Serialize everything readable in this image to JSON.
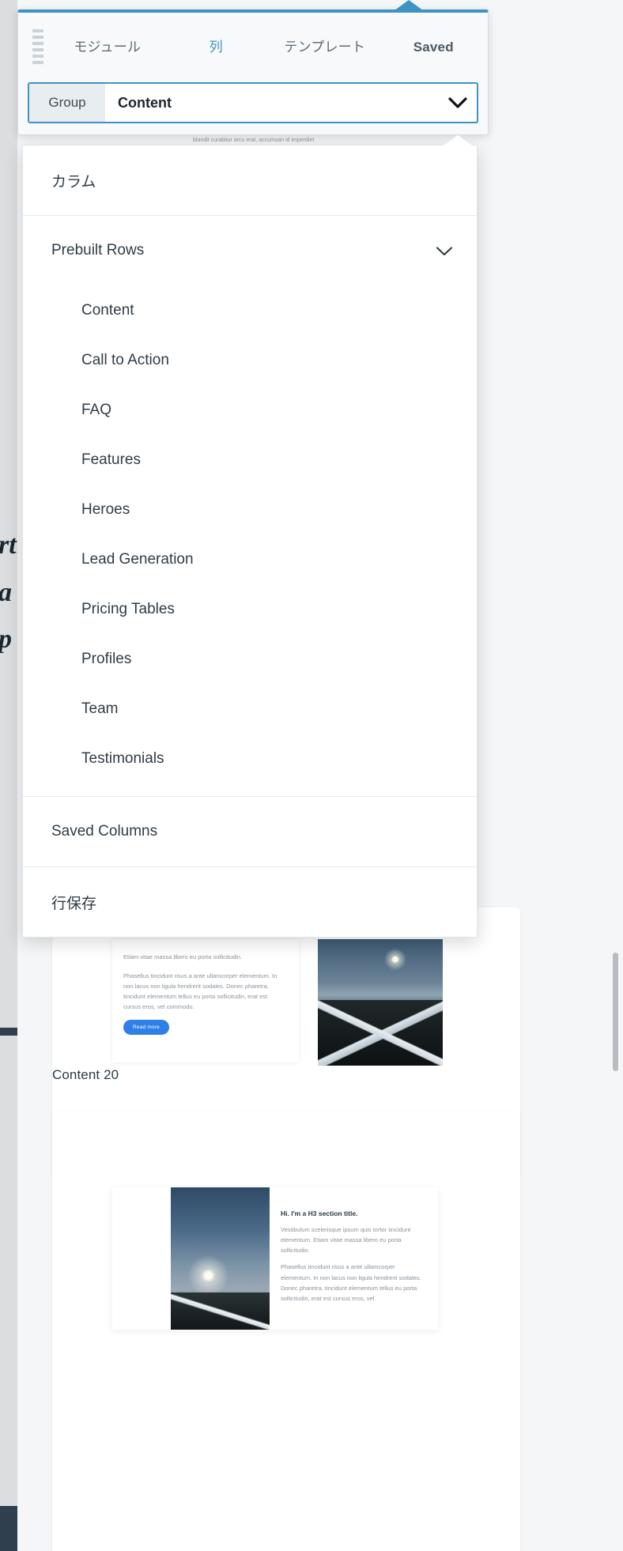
{
  "panel": {
    "tabs": [
      {
        "label": "モジュール",
        "state": "normal"
      },
      {
        "label": "列",
        "state": "active"
      },
      {
        "label": "テンプレート",
        "state": "normal"
      },
      {
        "label": "Saved",
        "state": "bold"
      }
    ],
    "group": {
      "label": "Group",
      "value": "Content",
      "chevron_icon": "chevron-down-icon"
    },
    "grip_icon": "drag-grip-icon",
    "caret_icon": "panel-caret-icon"
  },
  "dropdown": {
    "notch_icon": "dropdown-notch-icon",
    "sections": [
      {
        "label": "カラム",
        "type": "item"
      },
      {
        "label": "Prebuilt Rows",
        "type": "expandable",
        "chevron_icon": "chevron-down-icon",
        "expanded": true,
        "children": [
          "Content",
          "Call to Action",
          "FAQ",
          "Features",
          "Heroes",
          "Lead Generation",
          "Pricing Tables",
          "Profiles",
          "Team",
          "Testimonials"
        ]
      },
      {
        "label": "Saved Columns",
        "type": "item"
      },
      {
        "label": "行保存",
        "type": "item"
      }
    ]
  },
  "canvas": {
    "row_label_top": "Content 20",
    "card_top": {
      "lead": "Etiam vitae massa libero eu porta sollicitudin.",
      "body": "Phasellus tincidunt risus a ante ullamcorper elementum. In non lacus non ligula hendrerit sodales. Donec pharetra, tincidunt elementum tellus eu porta sollicitudin, erat est cursus eros, vel commodo.",
      "button": "Read more",
      "image_icon": "mountain-photo"
    },
    "card_bottom": {
      "title": "Hi. I'm a H3 section title.",
      "lead": "Vestibulum scelerisque ipsum quis tortor tincidunt elementum. Etiam vitae massa libero eu porta sollicitudin.",
      "body": "Phasellus tincidunt risus a ante ullamcorper elementum. In non lacus non ligula hendrerit sodales. Donec pharetra, tincidunt elementum tellus eu porta sollicitudin, erat est cursus eros, vel",
      "image_icon": "night-sky-photo"
    },
    "hidden_snippet": "blandit curabitur arcu erat, accumsan id imperdiet"
  },
  "colors": {
    "accent": "#3d94c4",
    "panel_bg": "#f7f9fa",
    "button_blue": "#2e7fe8",
    "text_dark": "#303c45"
  }
}
